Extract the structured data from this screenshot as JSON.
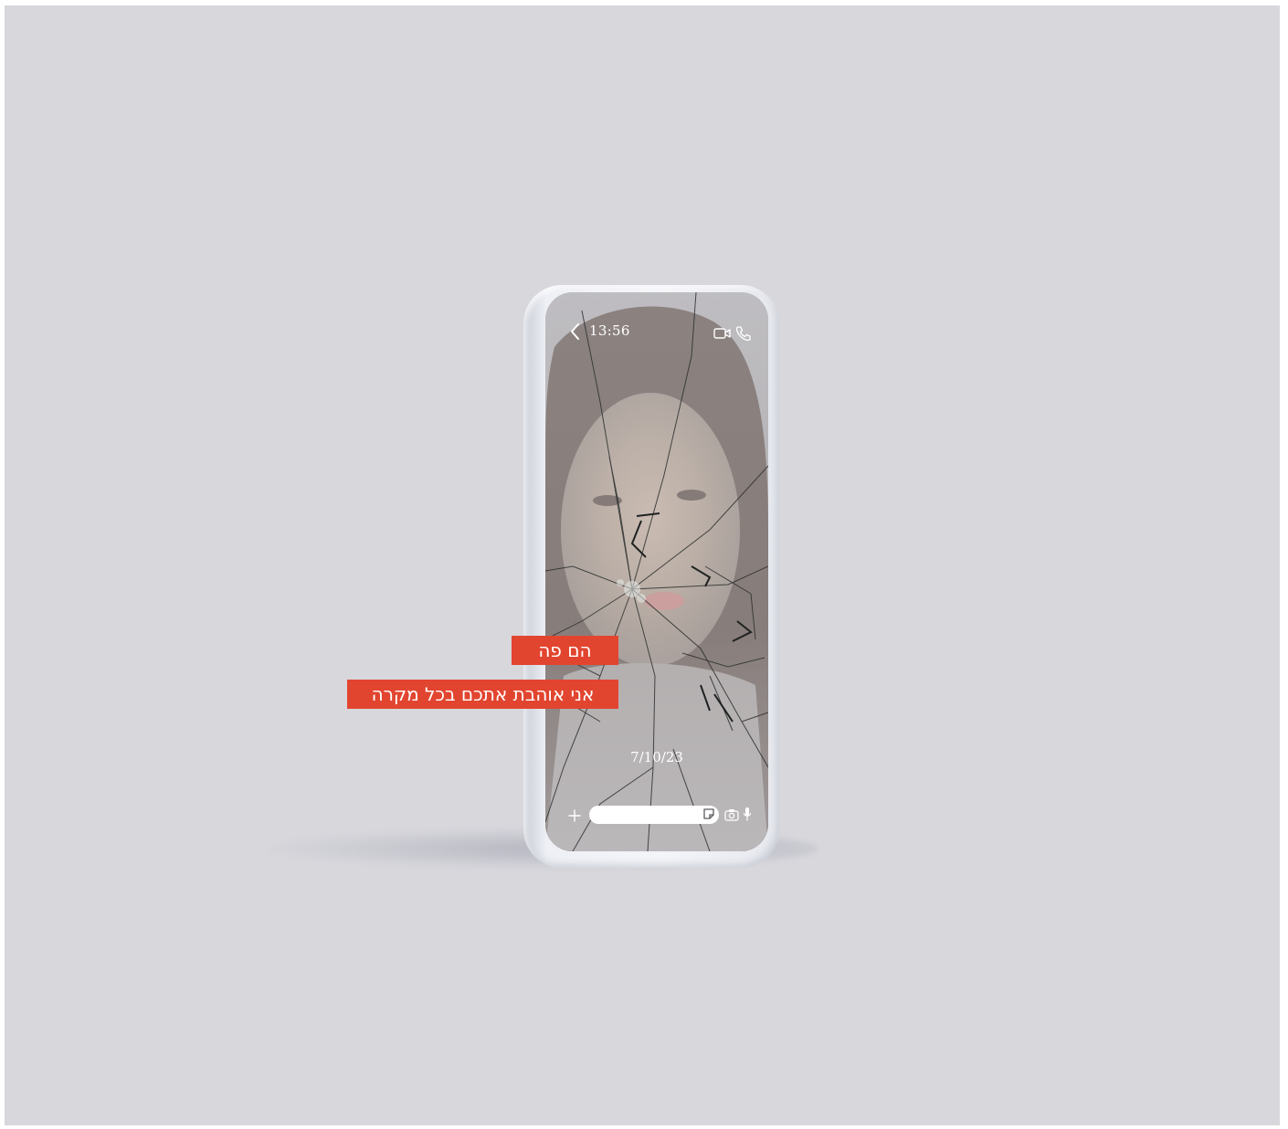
{
  "header": {
    "time": "13:56",
    "back_icon": "chevron-left-icon",
    "video_icon": "video-camera-icon",
    "call_icon": "phone-icon"
  },
  "conversation": {
    "date": "7/10/23",
    "background": "photo of a woman behind cracked glass"
  },
  "composer": {
    "add_icon": "plus-icon",
    "input_value": "",
    "sticker_icon": "sticker-icon",
    "camera_icon": "camera-icon",
    "mic_icon": "microphone-icon"
  },
  "captions": {
    "line1": "הם פה",
    "line2": "אני אוהבת אתכם בכל מקרה"
  },
  "colors": {
    "background": "#d7d7dc",
    "caption_bg": "#e2452f",
    "phone_body": "#eef0f5"
  }
}
